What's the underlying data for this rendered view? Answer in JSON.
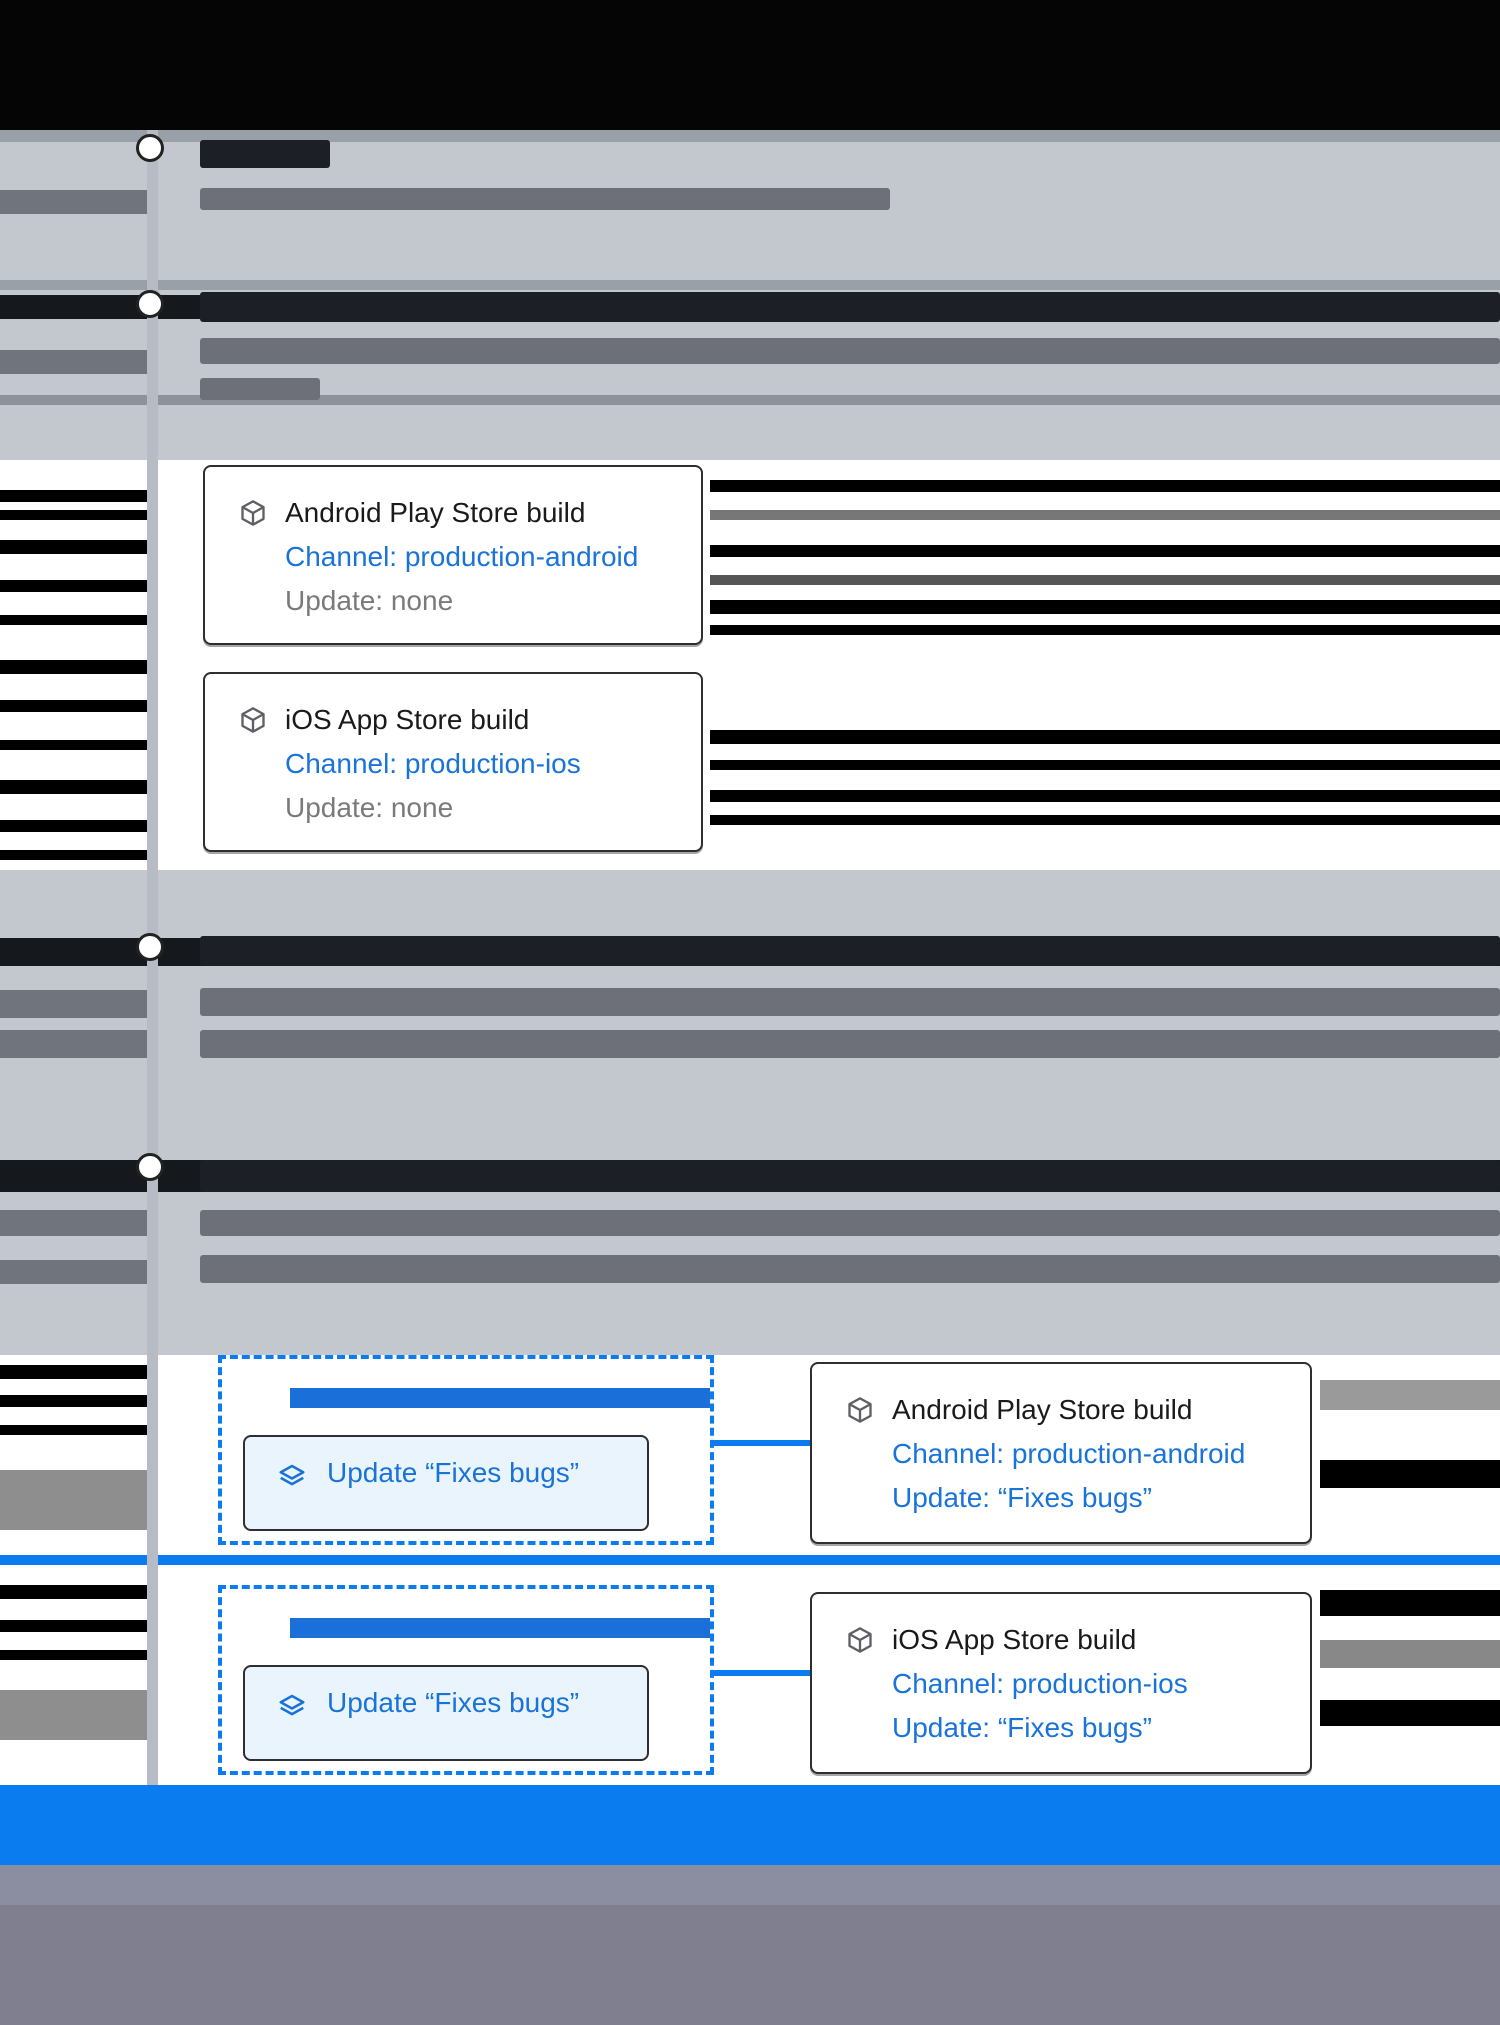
{
  "colors": {
    "accent": "#1a73d9",
    "track": "#b7bcc4",
    "background": "#c3c8cf"
  },
  "builds_before": [
    {
      "title": "Android Play Store build",
      "channel": "Channel: production-android",
      "update": "Update: none",
      "icon": "cube-icon"
    },
    {
      "title": "iOS App Store build",
      "channel": "Channel: production-ios",
      "update": "Update: none",
      "icon": "cube-icon"
    }
  ],
  "updates": [
    {
      "label": "Update “Fixes bugs”",
      "icon": "layers-icon"
    },
    {
      "label": "Update “Fixes bugs”",
      "icon": "layers-icon"
    }
  ],
  "builds_after": [
    {
      "title": "Android Play Store build",
      "channel": "Channel: production-android",
      "update": "Update: “Fixes bugs”",
      "icon": "cube-icon"
    },
    {
      "title": "iOS App Store build",
      "channel": "Channel: production-ios",
      "update": "Update: “Fixes bugs”",
      "icon": "cube-icon"
    }
  ]
}
